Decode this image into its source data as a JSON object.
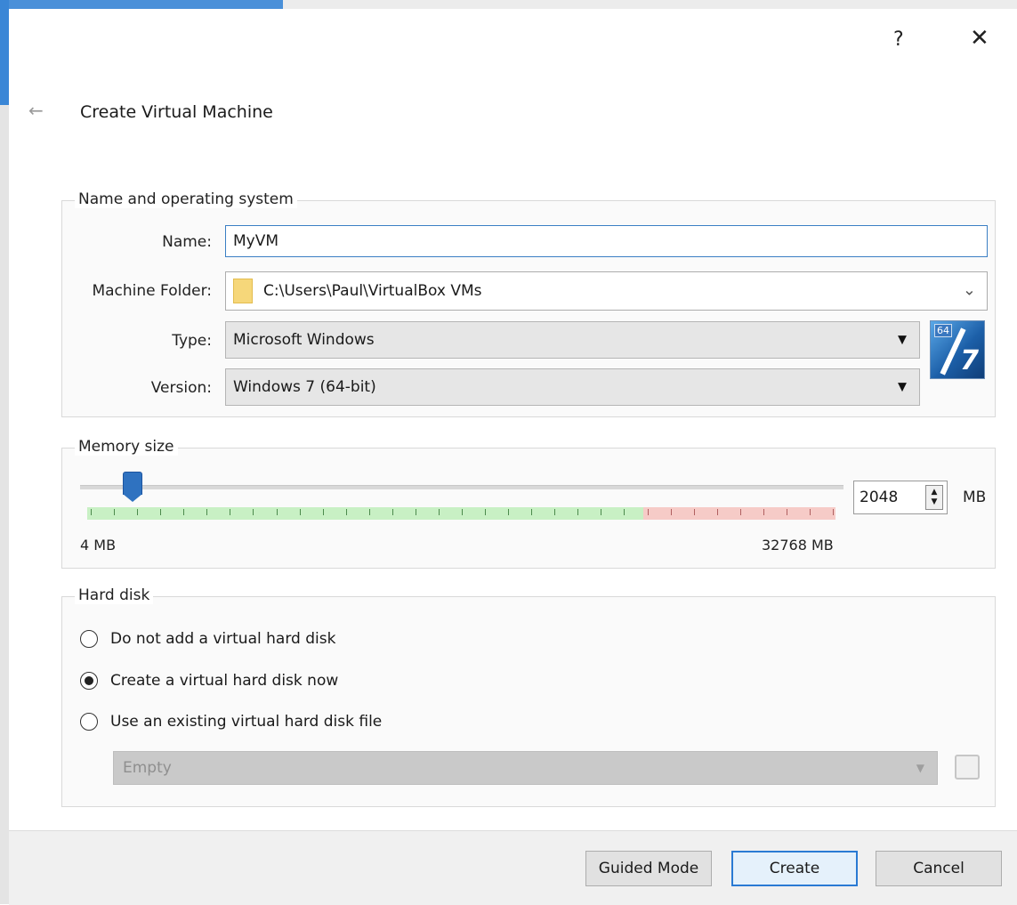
{
  "window": {
    "help_label": "?",
    "close_label": "✕",
    "back_label": "←",
    "title": "Create Virtual Machine"
  },
  "name_os": {
    "legend": "Name and operating system",
    "name_label": "Name:",
    "name_value": "MyVM",
    "folder_label": "Machine Folder:",
    "folder_value": "C:\\Users\\Paul\\VirtualBox VMs",
    "type_label": "Type:",
    "type_value": "Microsoft Windows",
    "version_label": "Version:",
    "version_value": "Windows 7 (64-bit)",
    "os_icon_badge": "64",
    "os_icon_numeral": "7"
  },
  "memory": {
    "legend": "Memory size",
    "value": "2048",
    "unit": "MB",
    "min_label": "4 MB",
    "max_label": "32768 MB",
    "slider_fraction": 0.0625
  },
  "hard_disk": {
    "legend": "Hard disk",
    "options": [
      {
        "label": "Do not add a virtual hard disk",
        "selected": false
      },
      {
        "label": "Create a virtual hard disk now",
        "selected": true
      },
      {
        "label": "Use an existing virtual hard disk file",
        "selected": false
      }
    ],
    "disk_file_value": "Empty"
  },
  "footer": {
    "guided_label": "Guided Mode",
    "create_label": "Create",
    "cancel_label": "Cancel"
  },
  "icons": {
    "folder": "folder-icon",
    "os": "windows-7-64bit-icon",
    "disk_folder": "choose-disk-file-icon"
  },
  "colors": {
    "accent": "#2a7ad3",
    "memory_safe": "#c8f0c4",
    "memory_unsafe": "#f6cbc7"
  }
}
